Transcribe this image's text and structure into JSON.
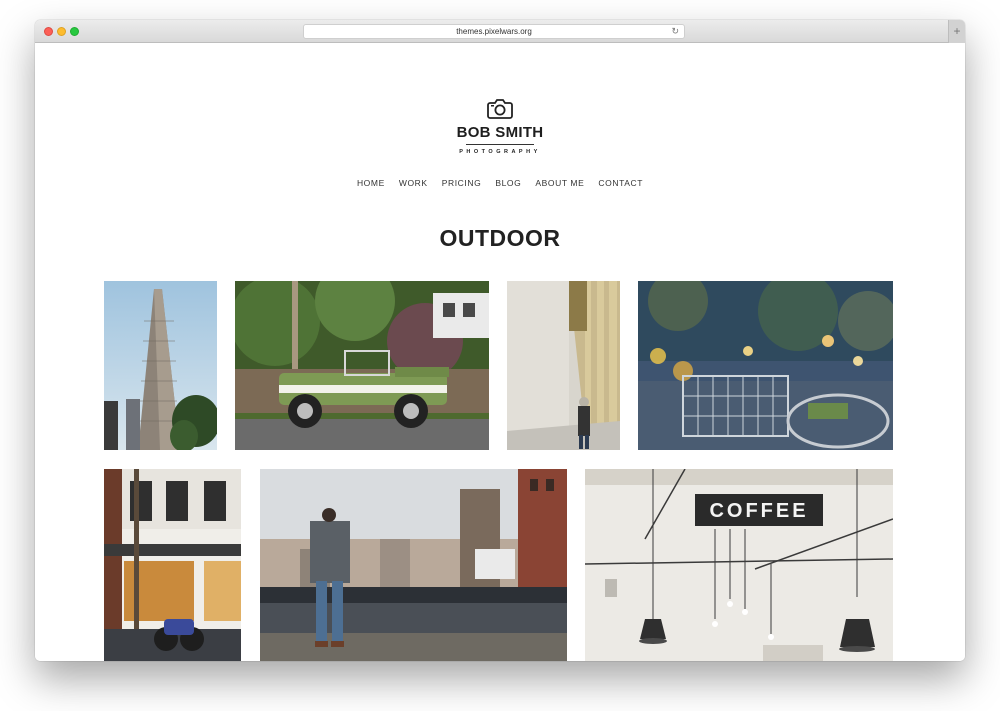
{
  "browser": {
    "url": "themes.pixelwars.org",
    "reload_glyph": "↻",
    "new_tab_glyph": "+"
  },
  "site": {
    "brand_name": "BOB SMITH",
    "brand_tagline": "PHOTOGRAPHY",
    "nav": [
      "HOME",
      "WORK",
      "PRICING",
      "BLOG",
      "ABOUT ME",
      "CONTACT"
    ],
    "page_title": "OUTDOOR"
  },
  "gallery": {
    "photos": [
      {
        "subject": "flatiron-building"
      },
      {
        "subject": "green-vintage-truck"
      },
      {
        "subject": "colonnade-walker"
      },
      {
        "subject": "bicycles-street"
      },
      {
        "subject": "motorcycle-storefront"
      },
      {
        "subject": "photographer-bridge"
      },
      {
        "subject": "coffee-shop-lamps",
        "sign_text": "COFFEE"
      }
    ]
  },
  "colors": {
    "close": "#fc5f57",
    "minimize": "#fdbc2e",
    "maximize": "#28c840",
    "text_dark": "#222222"
  }
}
